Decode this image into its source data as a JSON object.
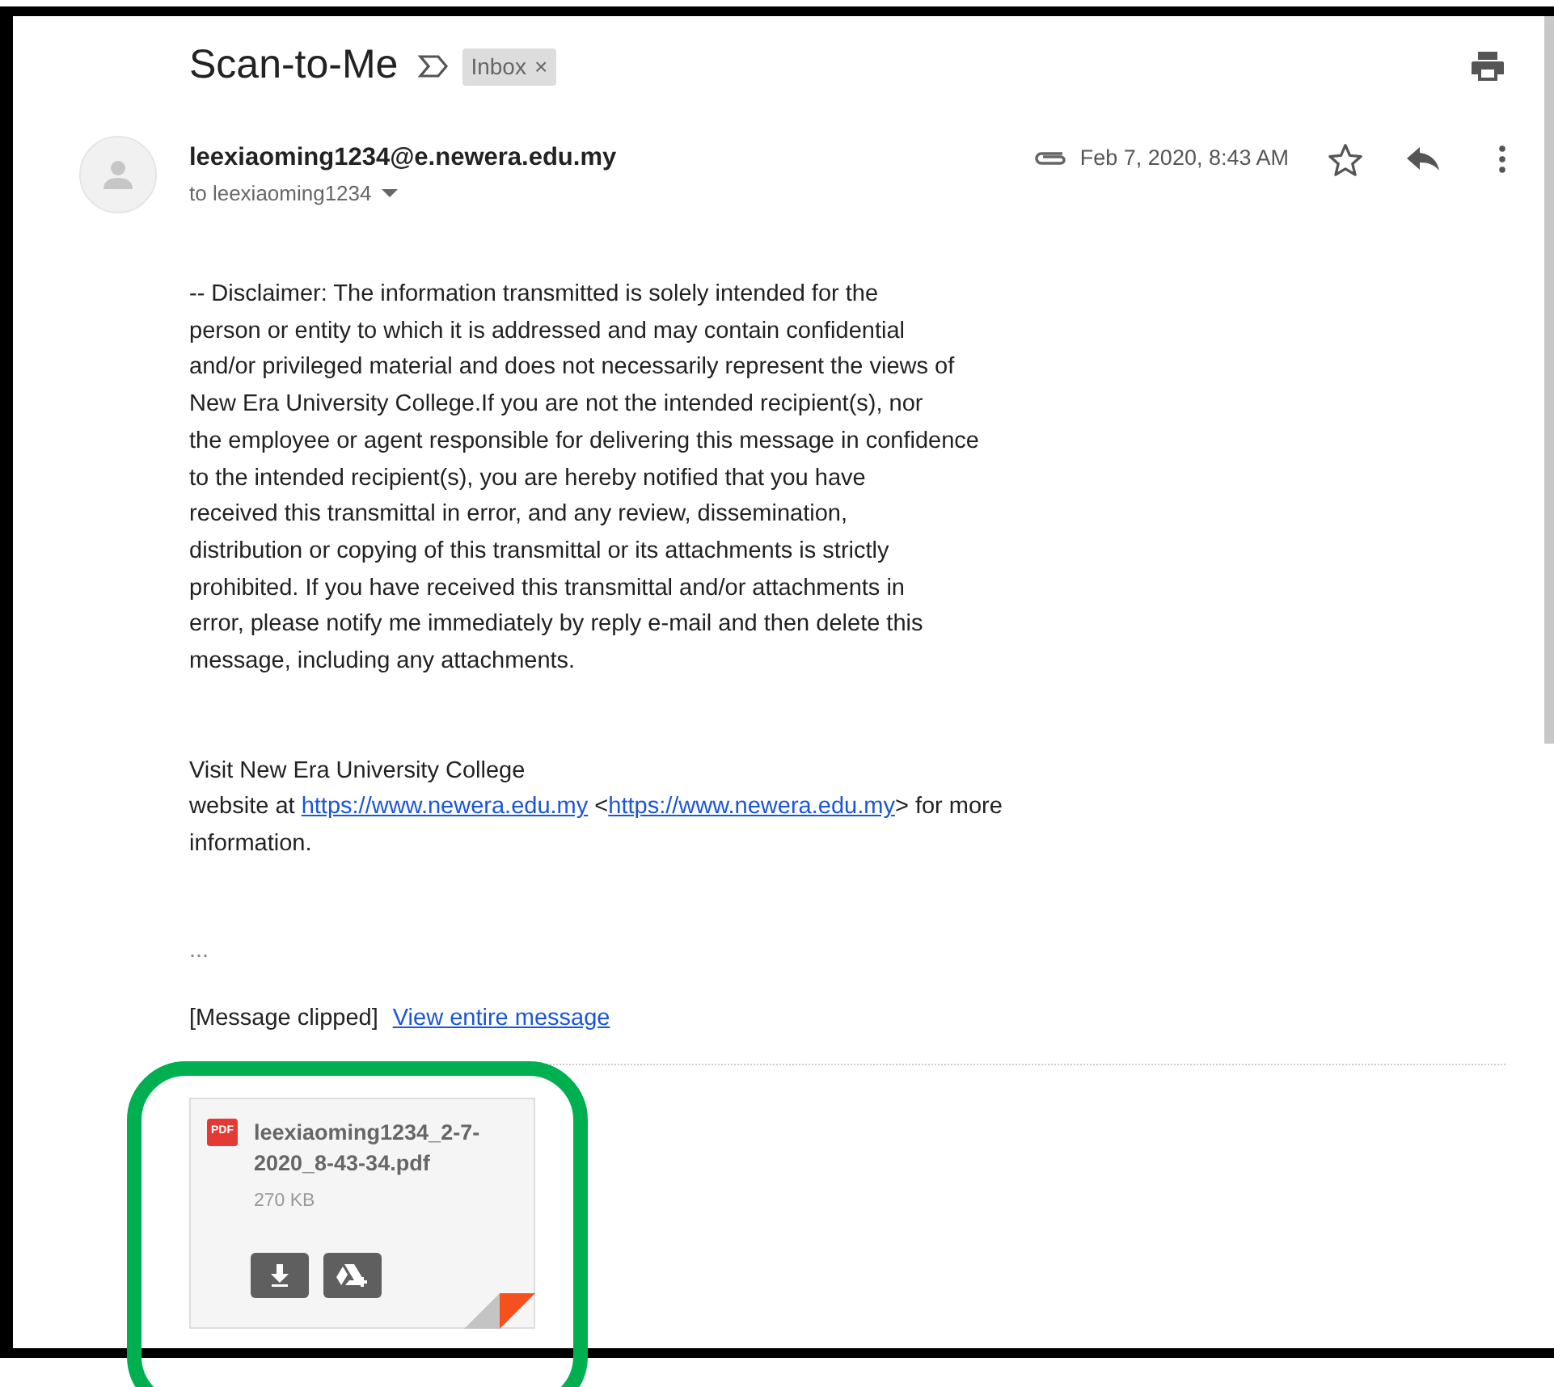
{
  "subject": {
    "title": "Scan-to-Me",
    "label": "Inbox",
    "label_remove": "×"
  },
  "message": {
    "sender": "leexiaoming1234@e.newera.edu.my",
    "to": "to leexiaoming1234",
    "date": "Feb 7, 2020, 8:43 AM",
    "has_attachment": true,
    "starred": false,
    "disclaimer_lines": [
      "-- Disclaimer: The information transmitted is solely intended for the",
      "person or entity to which it is addressed and may contain confidential",
      "and/or privileged material and does not necessarily represent the views of",
      "New Era University College.If you are not the intended recipient(s), nor",
      "the employee or agent responsible for delivering this message in confidence",
      "to the intended recipient(s), you are hereby notified that you have",
      "received this transmittal in error, and any review, dissemination,",
      "distribution or copying of this transmittal or its attachments is strictly",
      "prohibited. If you have received this transmittal and/or attachments in",
      "error, please notify me immediately by reply e-mail and then delete this",
      "message, including any attachments."
    ],
    "visit_line": "Visit New Era University College",
    "website_parts": [
      {
        "kind": "text",
        "text": "website at "
      },
      {
        "kind": "link",
        "text": "https://www.newera.edu.my"
      },
      {
        "kind": "text",
        "text": " <"
      },
      {
        "kind": "link",
        "text": "https://www.newera.edu.my"
      },
      {
        "kind": "text",
        "text": "> for more"
      }
    ],
    "info_line": "information.",
    "ellipsis": "...",
    "clipped_note": "[Message clipped]",
    "clipped_link": "View entire message"
  },
  "attachment": {
    "type_badge": "PDF",
    "name": "leexiaoming1234_2-7-2020_8-43-34.pdf",
    "size": "270 KB"
  }
}
